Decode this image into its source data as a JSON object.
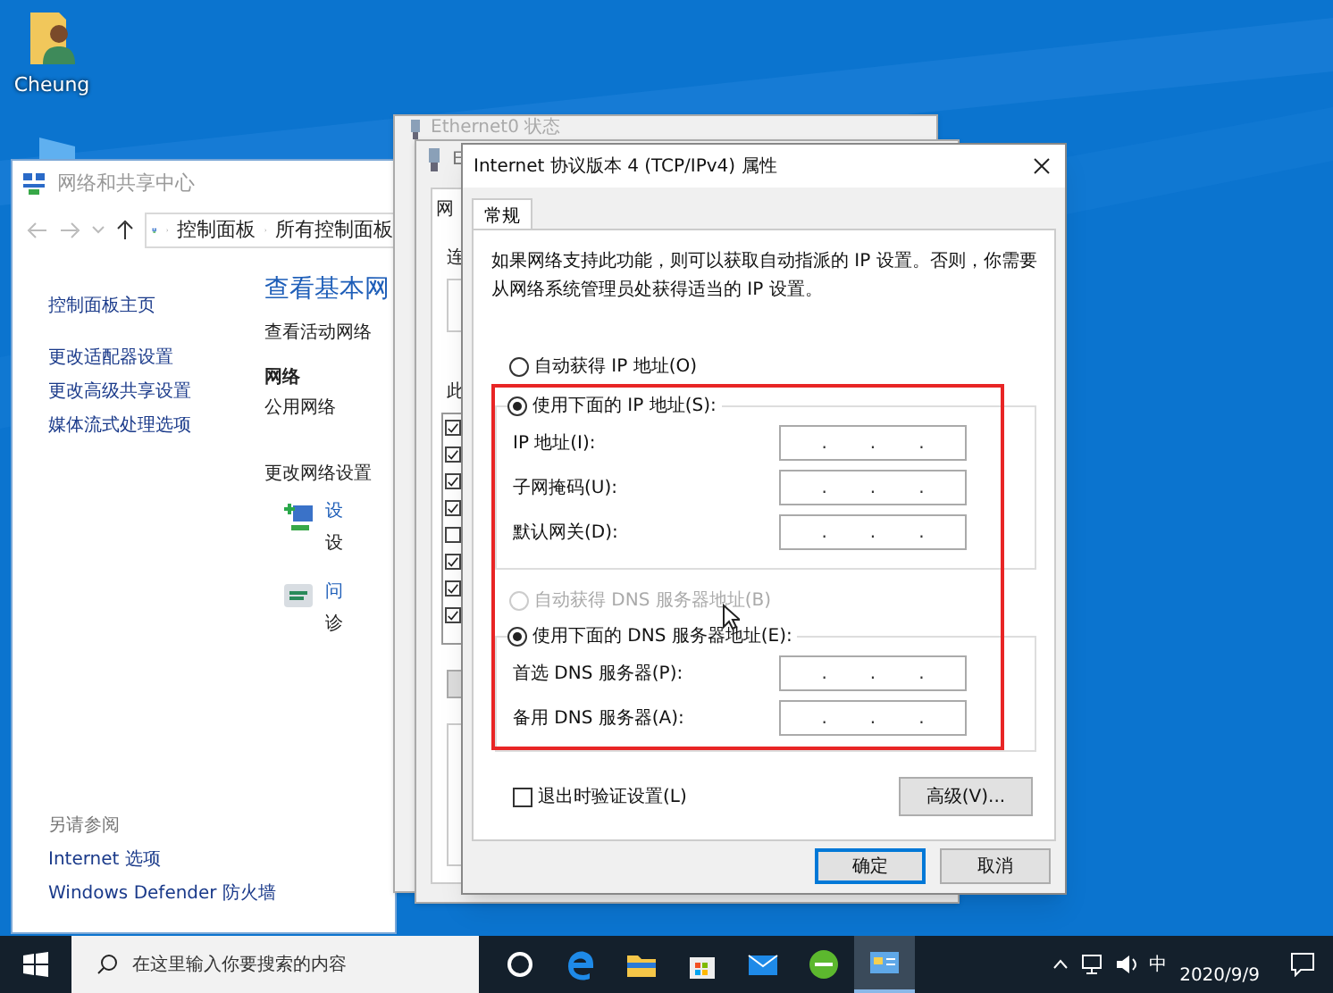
{
  "desktop_icons": [
    {
      "label": "Cheung"
    }
  ],
  "network_window": {
    "title": "网络和共享中心",
    "breadcrumb": [
      "控制面板",
      "所有控制面板"
    ],
    "sidebar_links": [
      "控制面板主页",
      "更改适配器设置",
      "更改高级共享设置",
      "媒体流式处理选项"
    ],
    "see_also": {
      "heading": "另请参阅",
      "links": [
        "Internet 选项",
        "Windows Defender 防火墙"
      ]
    },
    "heading": "查看基本网",
    "subheading": "查看活动网络",
    "network_name": "网络",
    "network_type": "公用网络",
    "change_heading": "更改网络设置",
    "tasks": [
      {
        "link": "设",
        "description": "设"
      },
      {
        "link": "问",
        "description": "诊"
      }
    ]
  },
  "status_window": {
    "title": "Ethernet0 状态"
  },
  "properties_window": {
    "title": "E",
    "tab": "网",
    "label_1": "连",
    "label_2": "此",
    "components": [
      {
        "checked": true
      },
      {
        "checked": true
      },
      {
        "checked": true
      },
      {
        "checked": true
      },
      {
        "checked": false
      },
      {
        "checked": true
      },
      {
        "checked": true
      },
      {
        "checked": true
      }
    ]
  },
  "dialog": {
    "title": "Internet 协议版本 4 (TCP/IPv4) 属性",
    "tabs": [
      {
        "label": "常规",
        "selected": true
      }
    ],
    "description": "如果网络支持此功能，则可以获取自动指派的 IP 设置。否则，你需要从网络系统管理员处获得适当的 IP 设置。",
    "ip_options": [
      {
        "label": "自动获得 IP 地址(O)",
        "selected": false,
        "disabled": false
      },
      {
        "label": "使用下面的 IP 地址(S):",
        "selected": true,
        "disabled": false
      }
    ],
    "ip_fields": [
      {
        "label": "IP 地址(I):",
        "value": "..."
      },
      {
        "label": "子网掩码(U):",
        "value": "..."
      },
      {
        "label": "默认网关(D):",
        "value": "..."
      }
    ],
    "dns_options": [
      {
        "label": "自动获得 DNS 服务器地址(B)",
        "selected": false,
        "disabled": true
      },
      {
        "label": "使用下面的 DNS 服务器地址(E):",
        "selected": true,
        "disabled": false
      }
    ],
    "dns_fields": [
      {
        "label": "首选 DNS 服务器(P):",
        "value": "..."
      },
      {
        "label": "备用 DNS 服务器(A):",
        "value": "..."
      }
    ],
    "validate": {
      "label": "退出时验证设置(L)",
      "checked": false
    },
    "advanced_button": "高级(V)...",
    "buttons": [
      {
        "label": "确定",
        "default": true
      },
      {
        "label": "取消",
        "default": false
      }
    ]
  },
  "taskbar": {
    "search_placeholder": "在这里输入你要搜索的内容",
    "apps": [
      {
        "kind": "cortana",
        "active": false
      },
      {
        "kind": "edge",
        "active": false
      },
      {
        "kind": "explorer",
        "active": false
      },
      {
        "kind": "store",
        "active": false
      },
      {
        "kind": "mail",
        "active": false
      },
      {
        "kind": "browser",
        "active": false
      },
      {
        "kind": "control-panel",
        "active": true
      }
    ],
    "ime": "中",
    "date": "2020/9/9"
  }
}
